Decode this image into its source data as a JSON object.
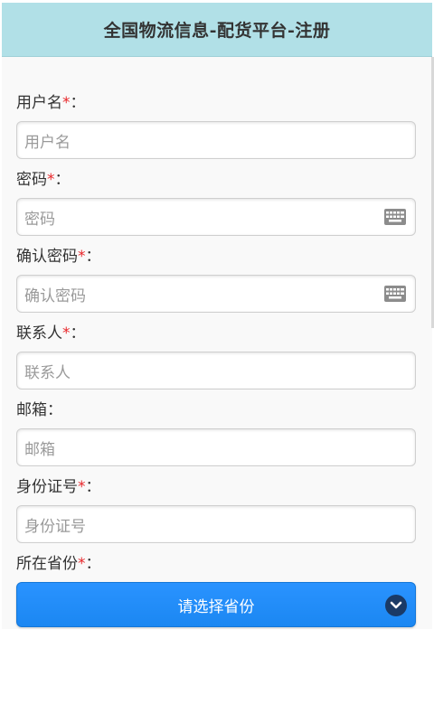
{
  "header": {
    "title": "全国物流信息-配货平台-注册"
  },
  "form": {
    "required_mark": "*",
    "colon": "：",
    "fields": [
      {
        "label": "用户名",
        "placeholder": "用户名",
        "required": true
      },
      {
        "label": "密码",
        "placeholder": "密码",
        "required": true,
        "icon": "keyboard-icon"
      },
      {
        "label": "确认密码",
        "placeholder": "确认密码",
        "required": true,
        "icon": "keyboard-icon"
      },
      {
        "label": "联系人",
        "placeholder": "联系人",
        "required": true
      },
      {
        "label": "邮箱",
        "placeholder": "邮箱",
        "required": false
      },
      {
        "label": "身份证号",
        "placeholder": "身份证号",
        "required": true
      }
    ],
    "province": {
      "label": "所在省份",
      "required": true,
      "selected": "请选择省份",
      "icon": "chevron-down-icon"
    }
  },
  "colors": {
    "header_bg": "#b1e0e7",
    "required": "#e8262a",
    "select_bg": "#1e8cf8"
  }
}
